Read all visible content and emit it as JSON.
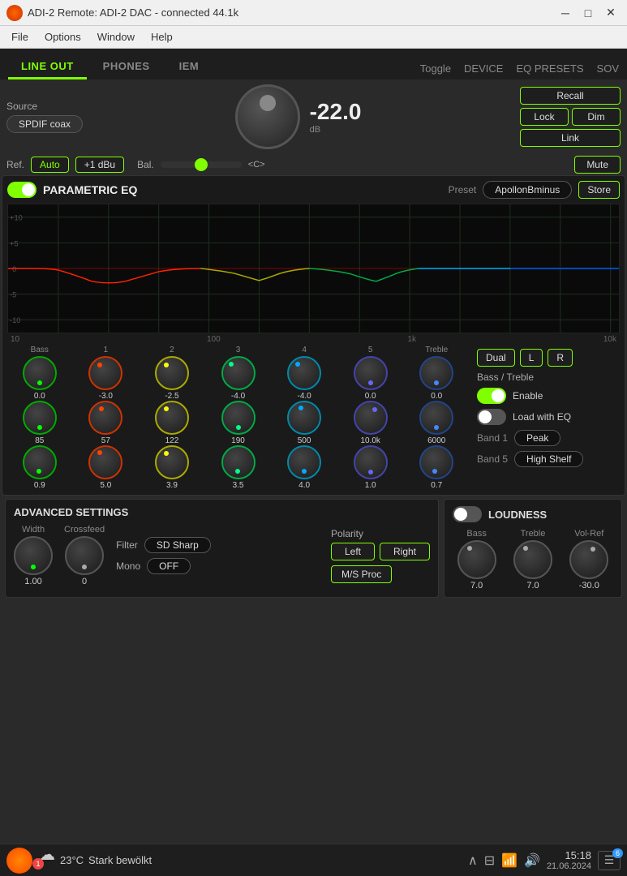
{
  "titlebar": {
    "title": "ADI-2 Remote: ADI-2 DAC - connected 44.1k",
    "min_btn": "─",
    "max_btn": "□",
    "close_btn": "✕"
  },
  "menubar": {
    "items": [
      "File",
      "Options",
      "Window",
      "Help"
    ]
  },
  "tabs": {
    "left": [
      {
        "label": "LINE OUT",
        "active": true
      },
      {
        "label": "PHONES",
        "active": false
      },
      {
        "label": "IEM",
        "active": false
      }
    ],
    "center": {
      "label": "Toggle"
    },
    "right": [
      {
        "label": "DEVICE"
      },
      {
        "label": "EQ PRESETS"
      },
      {
        "label": "SOV"
      }
    ]
  },
  "source": {
    "label": "Source",
    "value": "SPDIF coax"
  },
  "volume": {
    "value": "-22.0",
    "unit": "dB"
  },
  "buttons": {
    "recall": "Recall",
    "lock": "Lock",
    "dim": "Dim",
    "link": "Link",
    "mute": "Mute"
  },
  "ref": {
    "label": "Ref.",
    "auto": "Auto",
    "plus1dbu": "+1 dBu"
  },
  "balance": {
    "label": "Bal.",
    "center_label": "<C>"
  },
  "eq": {
    "title": "PARAMETRIC EQ",
    "enabled": true,
    "preset_label": "Preset",
    "preset_value": "ApollonBminus",
    "store_label": "Store",
    "freq_labels": [
      "10",
      "100",
      "1k",
      "10k"
    ],
    "db_labels": [
      "+10",
      "+5",
      "0",
      "-5",
      "-10"
    ],
    "bands": [
      {
        "label": "Bass",
        "gain": "0.0",
        "freq": "85",
        "q": "0.9",
        "color": "#00ff00",
        "dot_angle": 180
      },
      {
        "label": "1",
        "gain": "-3.0",
        "freq": "57",
        "q": "5.0",
        "color": "#ff4400",
        "dot_angle": 150
      },
      {
        "label": "2",
        "gain": "-2.5",
        "freq": "122",
        "q": "3.9",
        "color": "#ffff00",
        "dot_angle": 155
      },
      {
        "label": "3",
        "gain": "-4.0",
        "freq": "190",
        "q": "3.5",
        "color": "#00ff88",
        "dot_angle": 140
      },
      {
        "label": "4",
        "gain": "-4.0",
        "freq": "500",
        "q": "4.0",
        "color": "#00aaff",
        "dot_angle": 140
      },
      {
        "label": "5",
        "gain": "0.0",
        "freq": "10.0k",
        "q": "1.0",
        "color": "#6666ff",
        "dot_angle": 180
      },
      {
        "label": "Treble",
        "gain": "0.0",
        "freq": "6000",
        "q": "0.7",
        "color": "#4488ff",
        "dot_angle": 180
      }
    ],
    "right": {
      "dual_label": "Dual",
      "l_label": "L",
      "r_label": "R",
      "bass_treble_label": "Bass / Treble",
      "enable_label": "Enable",
      "load_with_eq_label": "Load with EQ",
      "band1_label": "Band 1",
      "band1_type": "Peak",
      "band5_label": "Band 5",
      "band5_type": "High Shelf"
    }
  },
  "advanced": {
    "title": "ADVANCED SETTINGS",
    "width_label": "Width",
    "width_val": "1.00",
    "crossfeed_label": "Crossfeed",
    "crossfeed_val": "0",
    "filter_label": "Filter",
    "filter_val": "SD Sharp",
    "mono_label": "Mono",
    "mono_val": "OFF",
    "polarity_label": "Polarity",
    "left_btn": "Left",
    "right_btn": "Right",
    "ms_proc_btn": "M/S Proc"
  },
  "loudness": {
    "title": "LOUDNESS",
    "enabled": false,
    "bass_label": "Bass",
    "bass_val": "7.0",
    "treble_label": "Treble",
    "treble_val": "7.0",
    "volref_label": "Vol-Ref",
    "volref_val": "-30.0"
  },
  "taskbar": {
    "weather_icon": "☁",
    "weather_badge": "1",
    "temp": "23°C",
    "weather_desc": "Stark bewölkt",
    "time": "15:18",
    "date": "21.06.2024",
    "notif_count": "6"
  }
}
